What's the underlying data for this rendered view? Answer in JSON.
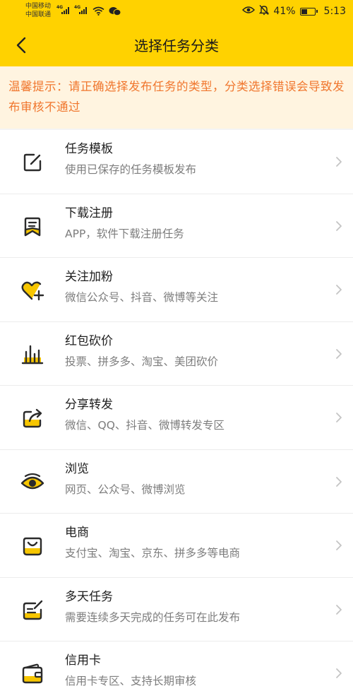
{
  "status_bar": {
    "carrier_1": "中国移动",
    "carrier_2": "中国联通",
    "net_1": "4G",
    "net_2": "4G",
    "battery_text": "41%",
    "battery_level": 0.41,
    "time": "5:13",
    "icons": [
      "signal-icon",
      "wifi-icon",
      "wechat-icon",
      "eye-icon",
      "mute-icon",
      "battery-icon"
    ]
  },
  "header": {
    "back_icon": "back-arrow-icon",
    "title": "选择任务分类"
  },
  "notice": {
    "text": "温馨提示：请正确选择发布任务的类型，分类选择错误会导致发布审核不通过"
  },
  "categories": [
    {
      "title": "任务模板",
      "desc": "使用已保存的任务模板发布",
      "icon": "edit-icon"
    },
    {
      "title": "下载注册",
      "desc": "APP，软件下载注册任务",
      "icon": "bookmark-icon"
    },
    {
      "title": "关注加粉",
      "desc": "微信公众号、抖音、微博等关注",
      "icon": "heart-plus-icon"
    },
    {
      "title": "红包砍价",
      "desc": "投票、拼多多、淘宝、美团砍价",
      "icon": "bar-chart-icon"
    },
    {
      "title": "分享转发",
      "desc": "微信、QQ、抖音、微博转发专区",
      "icon": "share-icon"
    },
    {
      "title": "浏览",
      "desc": "网页、公众号、微博浏览",
      "icon": "eye-icon"
    },
    {
      "title": "电商",
      "desc": "支付宝、淘宝、京东、拼多多等电商",
      "icon": "shopping-bag-icon"
    },
    {
      "title": "多天任务",
      "desc": "需要连续多天完成的任务可在此发布",
      "icon": "calendar-edit-icon"
    },
    {
      "title": "信用卡",
      "desc": "信用卡专区、支持长期审核",
      "icon": "wallet-icon"
    }
  ],
  "colors": {
    "brand_yellow": "#ffd200",
    "notice_bg": "#fff4e0",
    "notice_text": "#f0762d",
    "icon_dark": "#2b2b2b",
    "icon_accent": "#f7c600"
  }
}
